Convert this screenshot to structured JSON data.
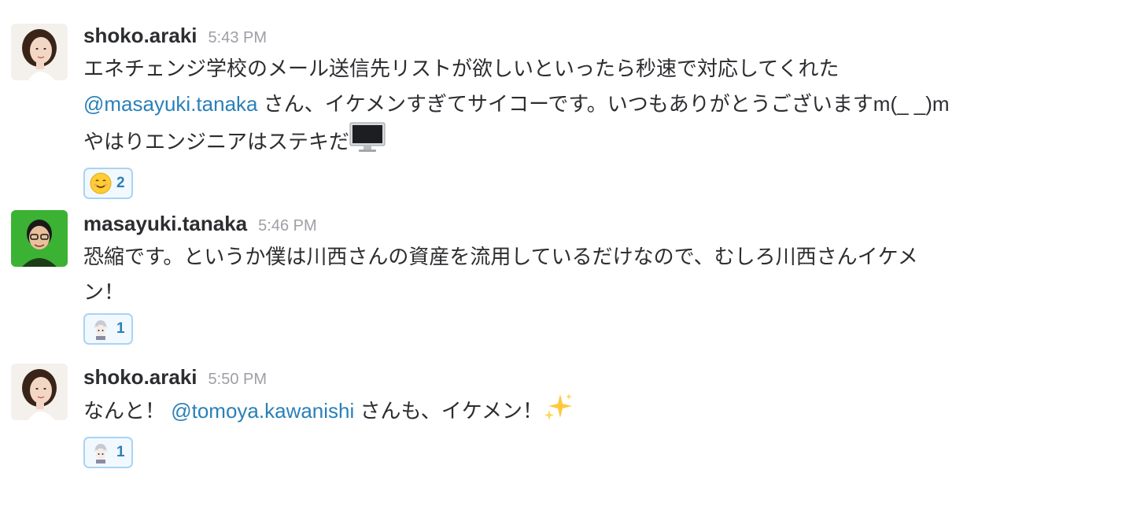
{
  "messages": [
    {
      "user": "shoko.araki",
      "time": "5:43 PM",
      "lines": [
        {
          "pre": "エネチェンジ学校のメール送信先リストが欲しいといったら秒速で対応してくれた"
        },
        {
          "mention": "@masayuki.tanaka",
          "post": " さん、イケメンすぎてサイコーです。いつもありがとうございますm(_ _)m"
        },
        {
          "pre": "やはりエンジニアはステキだ"
        }
      ],
      "inline_emoji": "desktop-computer-icon",
      "reaction": {
        "emoji": "smile-icon",
        "count": "2"
      }
    },
    {
      "user": "masayuki.tanaka",
      "time": "5:46 PM",
      "lines": [
        {
          "pre": "恐縮です。というか僕は川西さんの資産を流用しているだけなので、むしろ川西さんイケメ"
        },
        {
          "pre": "ン！"
        }
      ],
      "reaction": {
        "emoji": "custom-character-icon",
        "count": "1"
      }
    },
    {
      "user": "shoko.araki",
      "time": "5:50 PM",
      "lines": [
        {
          "pre": "なんと！ ",
          "mention": "@tomoya.kawanishi",
          "post": " さんも、イケメン！"
        }
      ],
      "inline_emoji": "sparkles-icon",
      "reaction": {
        "emoji": "custom-character-icon",
        "count": "1"
      }
    }
  ],
  "colors": {
    "mention": "#2a80b9",
    "timestamp": "#9e9ea6",
    "reaction_border": "#a8d4f5",
    "reaction_bg": "#f2f9fe"
  }
}
